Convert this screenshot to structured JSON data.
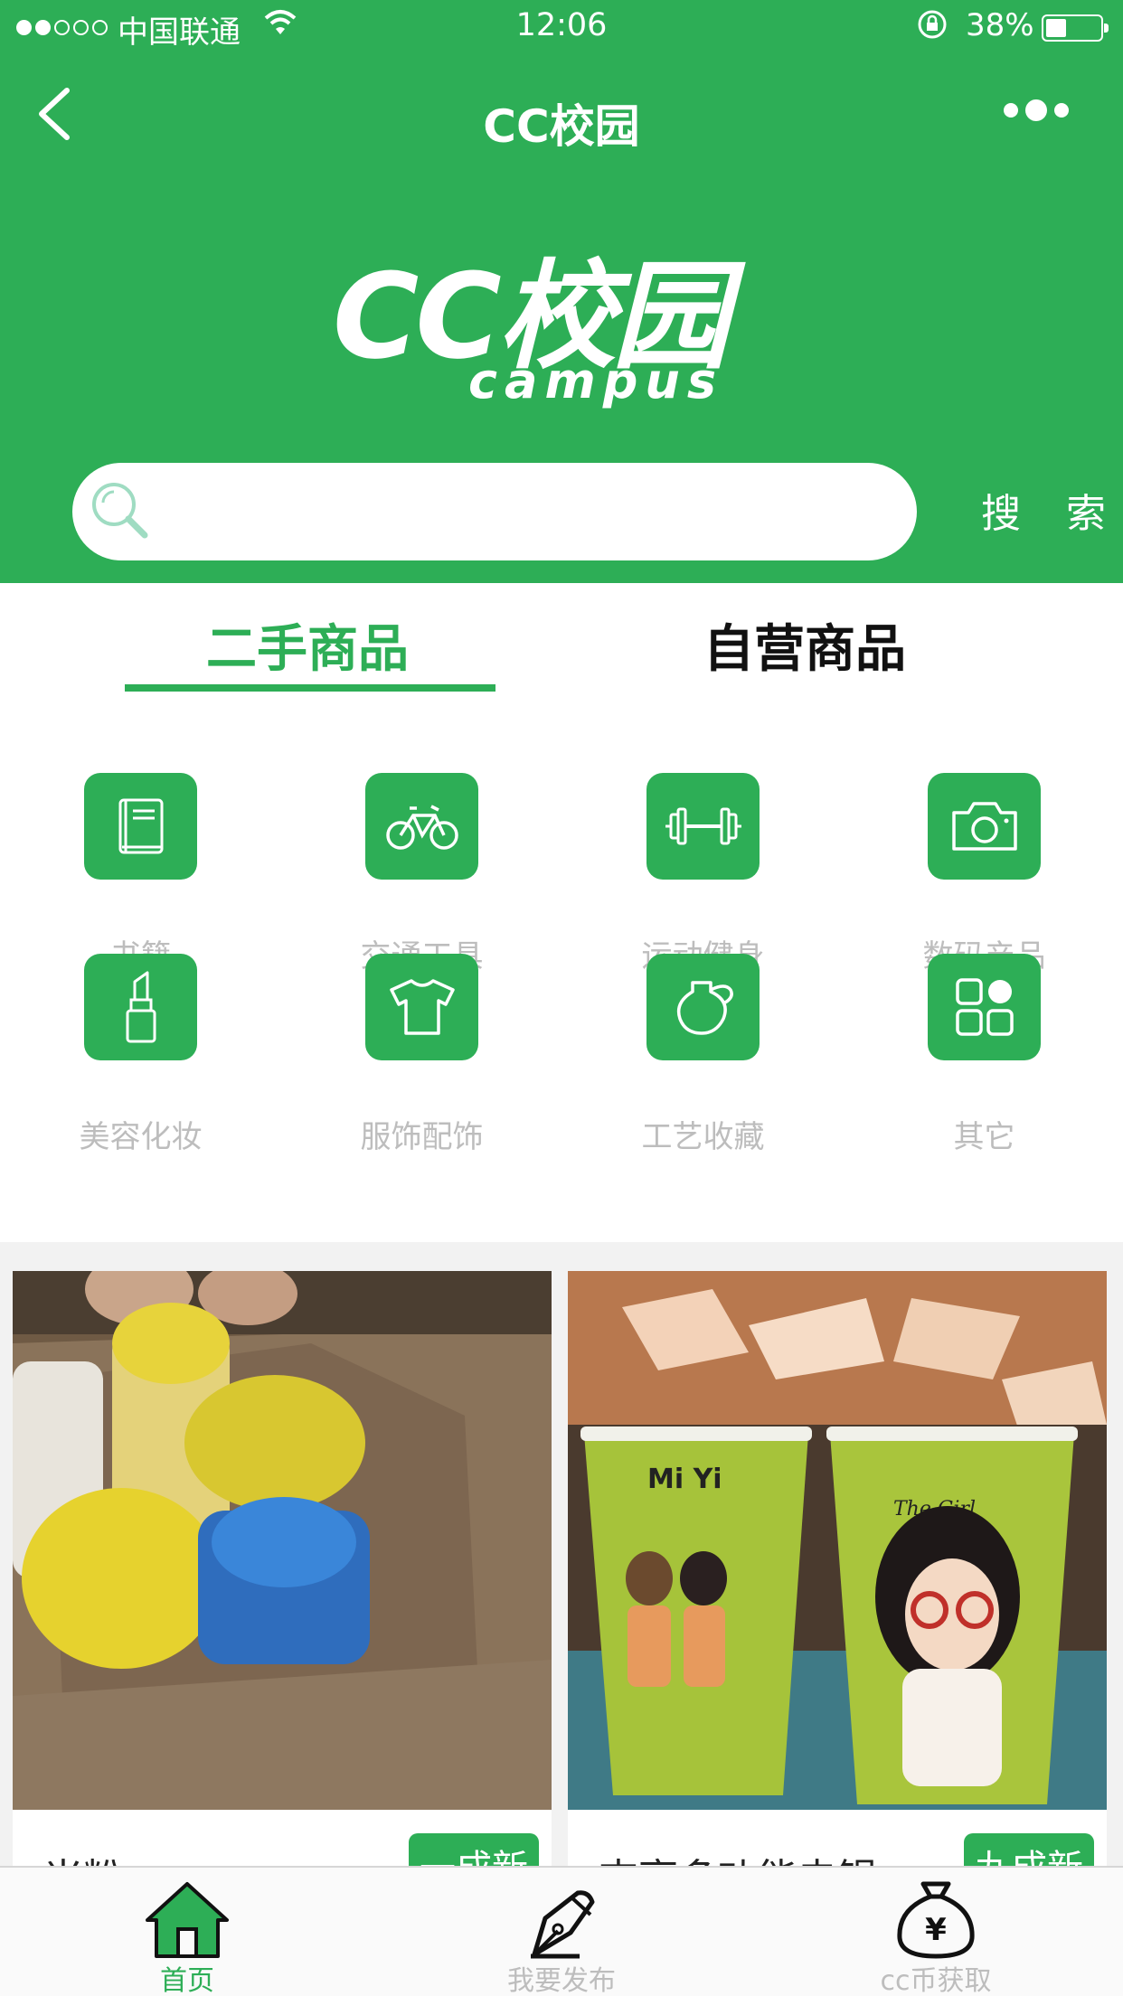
{
  "status_bar": {
    "carrier": "中国联通",
    "time": "12:06",
    "battery": "38%",
    "battery_level": 0.38
  },
  "nav": {
    "title": "CC校园"
  },
  "logo": {
    "main": "CC校园",
    "sub": "campus"
  },
  "search": {
    "placeholder": "",
    "button_label": "搜 索"
  },
  "tabs": [
    {
      "label": "二手商品",
      "active": true
    },
    {
      "label": "自营商品",
      "active": false
    }
  ],
  "categories": [
    {
      "label": "书籍",
      "icon": "book-icon"
    },
    {
      "label": "交通工具",
      "icon": "bicycle-icon"
    },
    {
      "label": "运动健身",
      "icon": "dumbbell-icon"
    },
    {
      "label": "数码产品",
      "icon": "camera-icon"
    },
    {
      "label": "美容化妆",
      "icon": "lipstick-icon"
    },
    {
      "label": "服饰配饰",
      "icon": "tshirt-icon"
    },
    {
      "label": "工艺收藏",
      "icon": "vase-icon"
    },
    {
      "label": "其它",
      "icon": "grid-icon"
    }
  ],
  "products": [
    {
      "title": "米粉",
      "badge": "一成新"
    },
    {
      "title": "吉亨多功能电锅",
      "badge": "九成新"
    }
  ],
  "tab_bar": [
    {
      "label": "首页",
      "icon": "home-icon",
      "active": true
    },
    {
      "label": "我要发布",
      "icon": "pen-icon",
      "active": false
    },
    {
      "label": "cc币获取",
      "icon": "money-bag-icon",
      "active": false
    }
  ],
  "colors": {
    "brand": "#2dae56",
    "muted": "#bdbdbd"
  }
}
